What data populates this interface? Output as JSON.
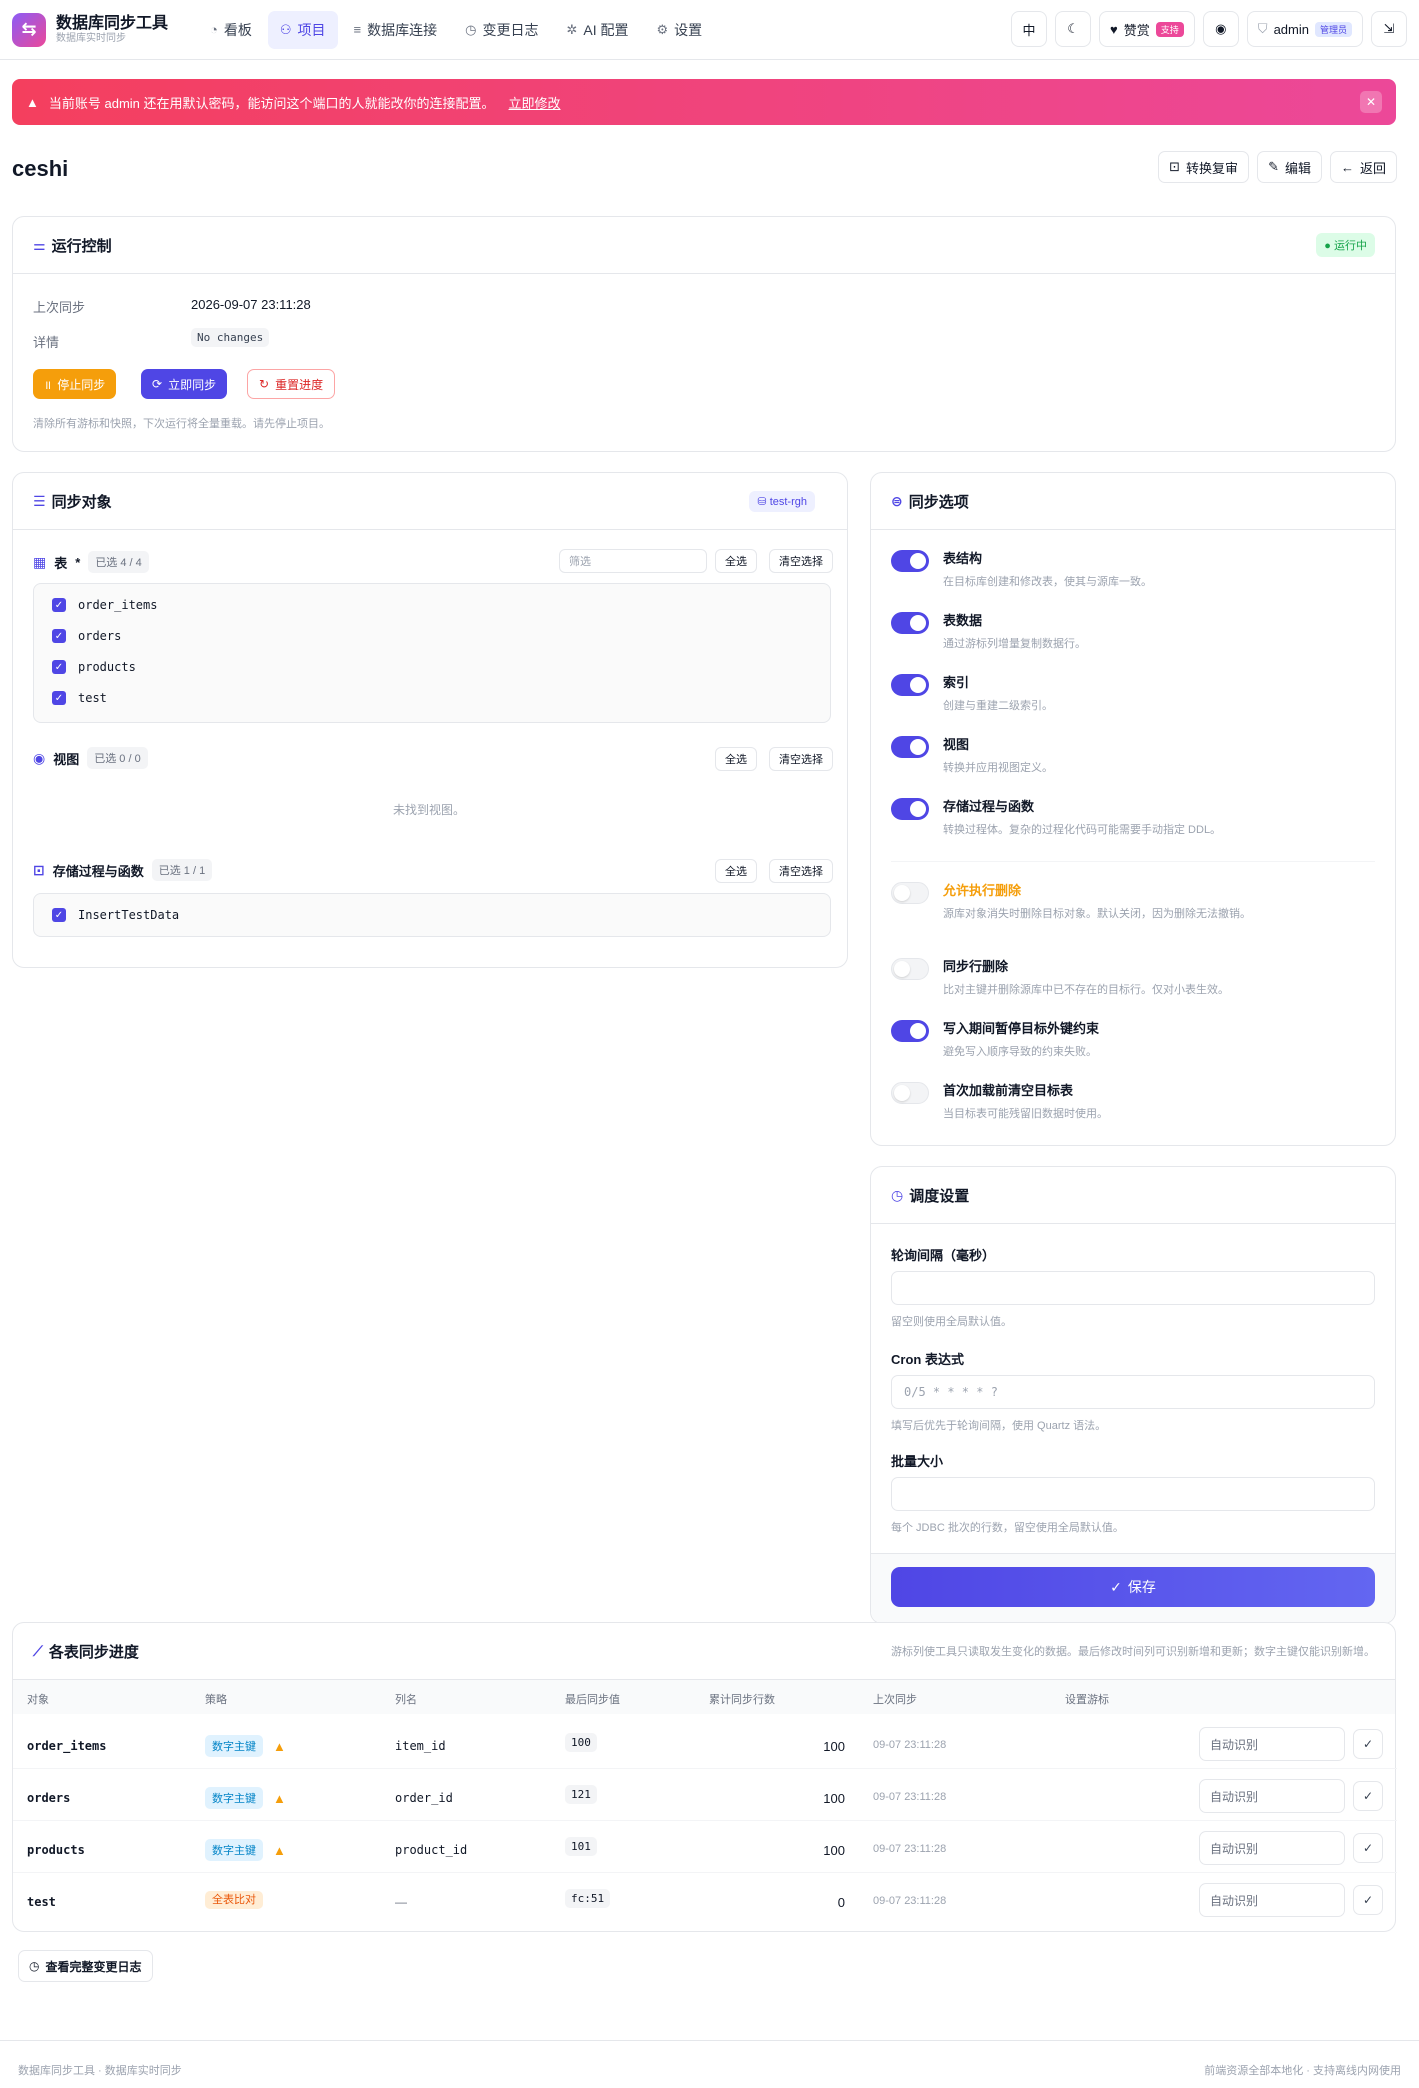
{
  "brand": {
    "title": "数据库同步工具",
    "subtitle": "数据库实时同步"
  },
  "nav": [
    {
      "icon": "◔",
      "label": "看板"
    },
    {
      "icon": "⚇",
      "label": "项目",
      "active": true
    },
    {
      "icon": "≡",
      "label": "数据库连接"
    },
    {
      "icon": "◷",
      "label": "变更日志"
    },
    {
      "icon": "✲",
      "label": "AI 配置"
    },
    {
      "icon": "⚙",
      "label": "设置"
    }
  ],
  "nav_right": {
    "lang": "中",
    "theme_icon": "☾",
    "donate": "赞赏",
    "donate_badge": "支持",
    "github_icon": "◉",
    "user": "admin",
    "user_badge": "管理员",
    "logout_icon": "⇲"
  },
  "alert": {
    "text": "当前账号 admin 还在用默认密码，能访问这个端口的人就能改你的连接配置。",
    "link": "立即修改",
    "close": "✕"
  },
  "page": {
    "title": "ceshi",
    "actions": [
      "转换复审",
      "编辑",
      "返回"
    ]
  },
  "run_control": {
    "title": "运行控制",
    "status": "运行中",
    "last_sync_label": "上次同步",
    "last_sync_value": "2026-09-07 23:11:28",
    "detail_label": "详情",
    "detail_value": "No changes",
    "buttons": [
      "停止同步",
      "立即同步",
      "重置进度"
    ],
    "note": "清除所有游标和快照，下次运行将全量重载。请先停止项目。"
  },
  "sync_objects": {
    "title": "同步对象",
    "source": "test-rgh",
    "tables": {
      "label": "表",
      "required": "*",
      "count": "已选 4 / 4",
      "filter_placeholder": "筛选",
      "select_all": "全选",
      "clear": "清空选择",
      "items": [
        "order_items",
        "orders",
        "products",
        "test"
      ]
    },
    "views": {
      "label": "视图",
      "count": "已选 0 / 0",
      "select_all": "全选",
      "clear": "清空选择",
      "empty": "未找到视图。"
    },
    "procs": {
      "label": "存储过程与函数",
      "count": "已选 1 / 1",
      "select_all": "全选",
      "clear": "清空选择",
      "items": [
        "InsertTestData"
      ]
    }
  },
  "sync_options": {
    "title": "同步选项",
    "items": [
      {
        "title": "表结构",
        "desc": "在目标库创建和修改表，使其与源库一致。",
        "on": true
      },
      {
        "title": "表数据",
        "desc": "通过游标列增量复制数据行。",
        "on": true
      },
      {
        "title": "索引",
        "desc": "创建与重建二级索引。",
        "on": true
      },
      {
        "title": "视图",
        "desc": "转换并应用视图定义。",
        "on": true
      },
      {
        "title": "存储过程与函数",
        "desc": "转换过程体。复杂的过程化代码可能需要手动指定 DDL。",
        "on": true
      },
      {
        "title": "允许执行删除",
        "desc": "源库对象消失时删除目标对象。默认关闭，因为删除无法撤销。",
        "on": false,
        "warn": true
      },
      {
        "title": "同步行删除",
        "desc": "比对主键并删除源库中已不存在的目标行。仅对小表生效。",
        "on": false
      },
      {
        "title": "写入期间暂停目标外键约束",
        "desc": "避免写入顺序导致的约束失败。",
        "on": true
      },
      {
        "title": "首次加载前清空目标表",
        "desc": "当目标表可能残留旧数据时使用。",
        "on": false
      }
    ]
  },
  "schedule": {
    "title": "调度设置",
    "poll_label": "轮询间隔（毫秒）",
    "poll_value": "",
    "poll_note": "留空则使用全局默认值。",
    "cron_label": "Cron 表达式",
    "cron_placeholder": "0/5 * * * * ?",
    "cron_note": "填写后优先于轮询间隔，使用 Quartz 语法。",
    "batch_label": "批量大小",
    "batch_value": "",
    "batch_note": "每个 JDBC 批次的行数，留空使用全局默认值。",
    "save": "保存"
  },
  "progress": {
    "title": "各表同步进度",
    "hint": "游标列使工具只读取发生变化的数据。最后修改时间列可识别新增和更新；数字主键仅能识别新增。",
    "columns": [
      "对象",
      "策略",
      "列名",
      "最后同步值",
      "累计同步行数",
      "上次同步",
      "设置游标"
    ],
    "rows": [
      {
        "object": "order_items",
        "strategy": "数字主键",
        "kind": "pk",
        "column": "item_id",
        "last": "100",
        "total": "100",
        "time": "09-07 23:11:28",
        "cursor": "自动识别"
      },
      {
        "object": "orders",
        "strategy": "数字主键",
        "kind": "pk",
        "column": "order_id",
        "last": "121",
        "total": "100",
        "time": "09-07 23:11:28",
        "cursor": "自动识别"
      },
      {
        "object": "products",
        "strategy": "数字主键",
        "kind": "pk",
        "column": "product_id",
        "last": "101",
        "total": "100",
        "time": "09-07 23:11:28",
        "cursor": "自动识别"
      },
      {
        "object": "test",
        "strategy": "全表比对",
        "kind": "full",
        "column": "—",
        "last": "fc:51",
        "total": "0",
        "time": "09-07 23:11:28",
        "cursor": "自动识别"
      }
    ],
    "changelog_btn": "查看完整变更日志"
  },
  "footer": {
    "left": "数据库同步工具 · 数据库实时同步",
    "right": "前端资源全部本地化 · 支持离线内网使用"
  }
}
